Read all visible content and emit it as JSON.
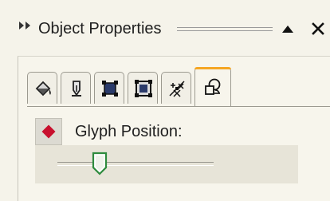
{
  "panel": {
    "title": "Object Properties",
    "collapse_icon": "double-chevron-right-icon",
    "minimize_icon": "triangle-up-icon",
    "close_icon": "close-icon"
  },
  "tabs": [
    {
      "name": "fill",
      "icon": "paint-bucket-icon"
    },
    {
      "name": "outline",
      "icon": "pen-nib-icon"
    },
    {
      "name": "object",
      "icon": "square-handles-icon"
    },
    {
      "name": "frame",
      "icon": "frame-icon"
    },
    {
      "name": "transparency",
      "icon": "sparkle-grid-icon"
    },
    {
      "name": "text",
      "icon": "shapes-icon",
      "active": true
    }
  ],
  "glyph_position": {
    "label": "Glyph Position:",
    "marker_color": "#c8102e",
    "slider_value": 0.27
  },
  "colors": {
    "accent_tab": "#f5a623",
    "slider_thumb": "#2e8b3e"
  }
}
